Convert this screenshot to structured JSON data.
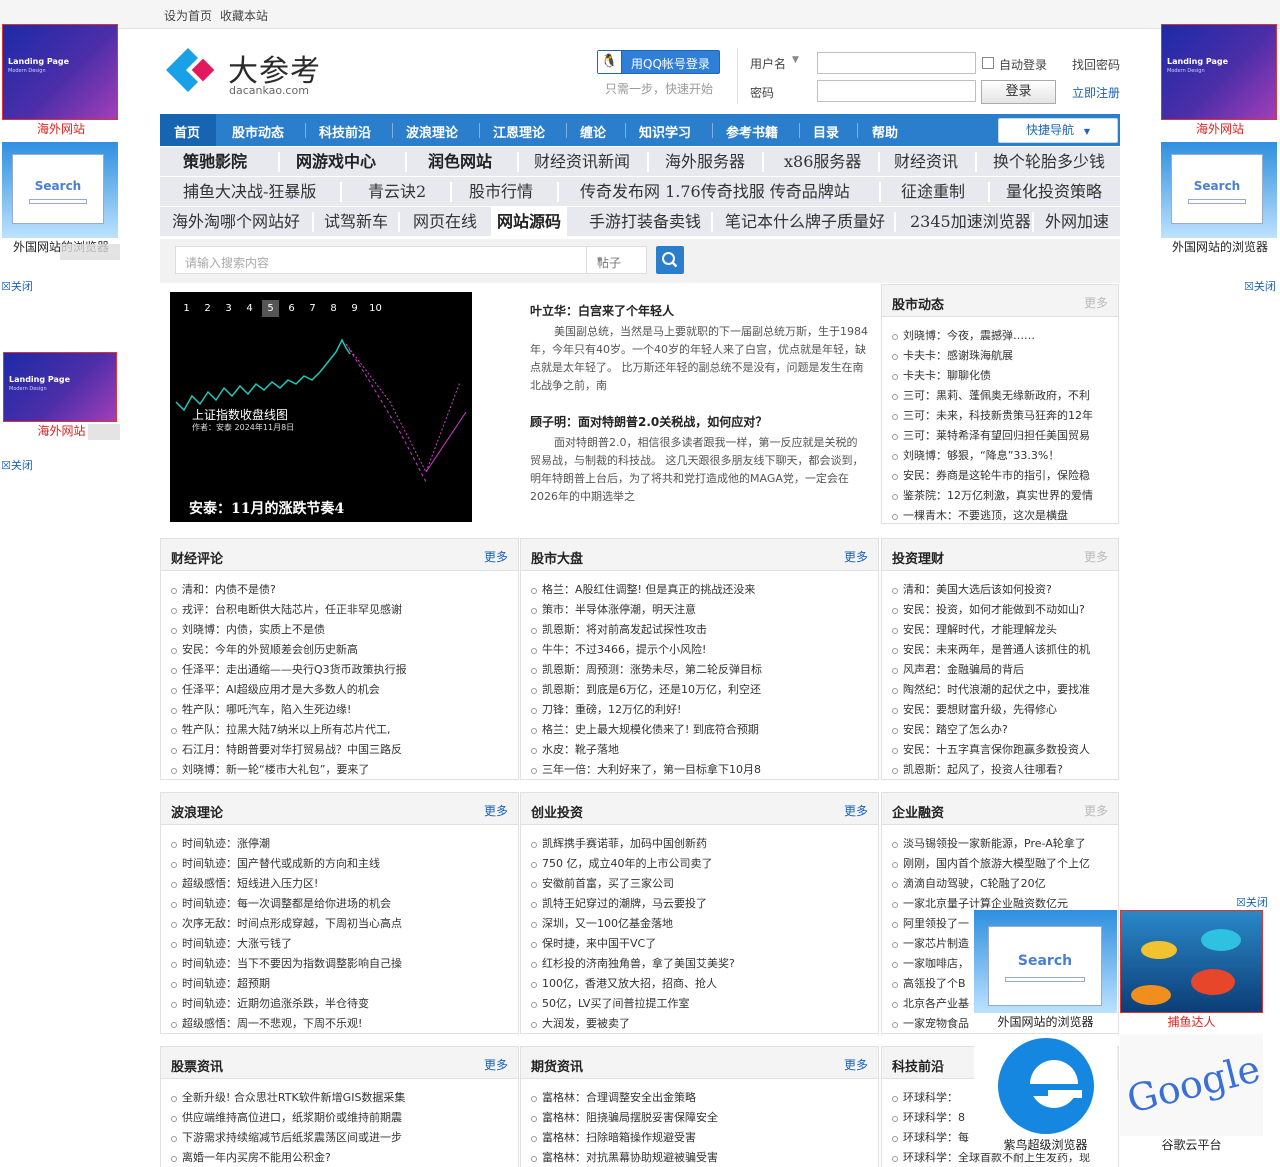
{
  "topbar": {
    "set_home": "设为首页",
    "bookmark": "收藏本站"
  },
  "logo": {
    "cn": "大参考",
    "en": "dacankao.com"
  },
  "login": {
    "qq_button": "用QQ帐号登录",
    "qq_hint": "只需一步，快速开始",
    "username_label": "用户名",
    "password_label": "密码",
    "auto_login": "自动登录",
    "find_password": "找回密码",
    "login_button": "登录",
    "register": "立即注册"
  },
  "nav": {
    "items": [
      "首页",
      "股市动态",
      "科技前沿",
      "波浪理论",
      "江恩理论",
      "缠论",
      "知识学习",
      "参考书籍",
      "目录",
      "帮助"
    ],
    "quick": "快捷导航"
  },
  "keywords": {
    "row1": [
      "策驰影院",
      "网游戏中心",
      "润色网站",
      "财经资讯新闻",
      "海外服务器",
      "x86服务器",
      "财经资讯",
      "换个轮胎多少钱"
    ],
    "row2": [
      "捕鱼大决战-狂暴版",
      "青云诀2",
      "股市行情",
      "传奇发布网 1.76传奇找服 传奇品牌站",
      "征途重制",
      "量化投资策略"
    ],
    "row3": [
      "海外淘哪个网站好",
      "试驾新车",
      "网页在线",
      "网站源码",
      "手游打装备卖钱",
      "笔记本什么牌子质量好",
      "2345加速浏览器",
      "外网加速"
    ]
  },
  "search": {
    "placeholder": "请输入搜索内容",
    "type": "帖子"
  },
  "banner": {
    "pages": [
      "1",
      "2",
      "3",
      "4",
      "5",
      "6",
      "7",
      "8",
      "9",
      "10"
    ],
    "active": "5",
    "caption": "安泰：11月的涨跌节奏4",
    "chart_title": "上证指数收盘线图",
    "chart_sub": "作者：安泰 2024年11月8日"
  },
  "articles": [
    {
      "title": "叶立华：白宫来了个年轻人",
      "body": "美国副总统，当然是马上要就职的下一届副总统万斯，生于1984年，今年只有40岁。一个40岁的年轻人来了白宫，优点就是年轻，缺点就是太年轻了。 比万斯还年轻的副总统不是没有，问题是发生在南北战争之前，南"
    },
    {
      "title": "顾子明：面对特朗普2.0关税战，如何应对？",
      "body": "面对特朗普2.0，相信很多读者跟我一样，第一反应就是关税的贸易战，与制裁的科技战。 这几天跟很多朋友线下聊天，都会谈到，明年特朗普上台后，为了将共和党打造成他的MAGA党，一定会在2026年的中期选举之"
    }
  ],
  "sections": {
    "stock_news": {
      "title": "股市动态",
      "more": "更多",
      "items": [
        "刘晓博：今夜，震撼弹……",
        "卡夫卡：感谢珠海航展",
        "卡夫卡：聊聊化债",
        "三可：黑莉、蓬佩奥无缘新政府，不利",
        "三可：未来，科技新贵策马狂奔的12年",
        "三可：莱特希泽有望回归担任美国贸易",
        "刘晓博：够狠，“降息”33.3%！",
        "安民：券商是这轮牛市的指引，保险稳",
        "鉴茶院：12万亿刺激，真实世界的爱情",
        "一棵青木：不要逃顶，这次是横盘"
      ]
    },
    "finance_comment": {
      "title": "财经评论",
      "more": "更多",
      "items": [
        "清和：内债不是债?",
        "戎评：台积电断供大陆芯片，任正非罕见感谢",
        "刘晓博：内债，实质上不是债",
        "安民：今年的外贸顺差会创历史新高",
        "任泽平：走出通缩——央行Q3货币政策执行报",
        "任泽平：AI超级应用才是大多数人的机会",
        "牲产队：哪吒汽车，陷入生死边缘!",
        "牲产队：拉黑大陆7纳米以上所有芯片代工,",
        "石江月：特朗普要对华打贸易战？中国三路反",
        "刘晓博：新一轮“楼市大礼包”，要来了"
      ]
    },
    "market": {
      "title": "股市大盘",
      "more": "更多",
      "items": [
        "格兰：A股红住调整! 但是真正的挑战还没来",
        "策市：半导体涨停潮，明天注意",
        "凯恩斯：将对前高发起试探性攻击",
        "牛牛：不过3466，提示个小风险!",
        "凯恩斯：周预测：涨势未尽，第二轮反弹目标",
        "凯恩斯：到底是6万亿，还是10万亿，利空还",
        "刀锋：重磅，12万亿的利好!",
        "格兰：史上最大规模化债来了! 到底符合预期",
        "水皮：靴子落地",
        "三年一倍：大利好来了，第一目标拿下10月8"
      ]
    },
    "invest": {
      "title": "投资理财",
      "more": "更多",
      "items": [
        "清和：美国大选后该如何投资?",
        "安民：投资，如何才能做到不动如山?",
        "安民：理解时代，才能理解龙头",
        "安民：未来两年，是普通人该抓住的机",
        "风声君：金融骗局的背后",
        "陶然纪：时代浪潮的起伏之中，要找准",
        "安民：要想财富升级，先得修心",
        "安民：踏空了怎么办?",
        "安民：十五字真言保你跑赢多数投资人",
        "凯恩斯：起风了，投资人往哪看?"
      ]
    },
    "wave": {
      "title": "波浪理论",
      "more": "更多",
      "items": [
        "时间轨迹：涨停潮",
        "时间轨迹：国产替代或成新的方向和主线",
        "超级感悟：短线进入压力区!",
        "时间轨迹：每一次调整都是给你进场的机会",
        "次序无敌：时间点形成穿越，下周初当心高点",
        "时间轨迹：大涨亏钱了",
        "时间轨迹：当下不要因为指数调整影响自己操",
        "时间轨迹：超预期",
        "时间轨迹：近期勿追涨杀跌，半仓待变",
        "超级感悟：周一不悲观，下周不乐观!"
      ]
    },
    "venture": {
      "title": "创业投资",
      "more": "更多",
      "items": [
        "凯辉携手赛诺菲，加码中国创新药",
        "750 亿，成立40年的上市公司卖了",
        "安徽前首富，买了三家公司",
        "凯特王妃穿过的潮牌，马云要投了",
        "深圳，又一100亿基金落地",
        "保时捷，来中国干VC了",
        "红杉投的济南独角兽，拿了美国艾美奖?",
        "100亿，香港又放大招，招商、抢人",
        "50亿，LV买了间普拉提工作室",
        "大润发，要被卖了"
      ]
    },
    "corp_finance": {
      "title": "企业融资",
      "more": "更多",
      "items": [
        "淡马锡领投一家新能源，Pre-A轮拿了",
        "刚刚，国内首个旅游大模型融了个上亿",
        "滴滴自动驾驶，C轮融了20亿",
        "一家北京量子计算企业融资数亿元",
        "阿里领投了一",
        "一家芯片制造",
        "一家咖啡店，",
        "高瓴投了个B",
        "北京各产业基",
        "一家宠物食品"
      ]
    },
    "stock_info": {
      "title": "股票资讯",
      "more": "更多",
      "items": [
        "全新升级! 合众思壮RTK软件新增GIS数据采集",
        "供应端维持高位进口，纸浆期价或维持前期震",
        "下游需求持续缩减节后纸浆震荡区间或进一步",
        "离婚一年内买房不能用公积金?"
      ]
    },
    "futures": {
      "title": "期货资讯",
      "more": "更多",
      "items": [
        "富格林：合理调整安全出金策略",
        "富格林：阻挠骗局摆脱妥害保障安全",
        "富格林：扫除暗箱操作规避受害",
        "富格林：对抗黑幕协助规避被骗受害"
      ]
    },
    "tech": {
      "title": "科技前沿",
      "more": "更多",
      "items": [
        "环球科学：",
        "环球科学：8",
        "环球科学：每",
        "环球科学：全球首款不耐上生发药，现"
      ]
    }
  },
  "ads": {
    "overseas": "海外网站",
    "browser": "外国网站的浏览器",
    "close": "关闭",
    "fishing": "捕鱼达人",
    "ziniao": "紫鸟超级浏览器",
    "guge": "谷歌云平台",
    "lp_title": "Landing Page",
    "lp_sub": "Modern Design",
    "search_word": "Search",
    "google_word": "Google"
  }
}
